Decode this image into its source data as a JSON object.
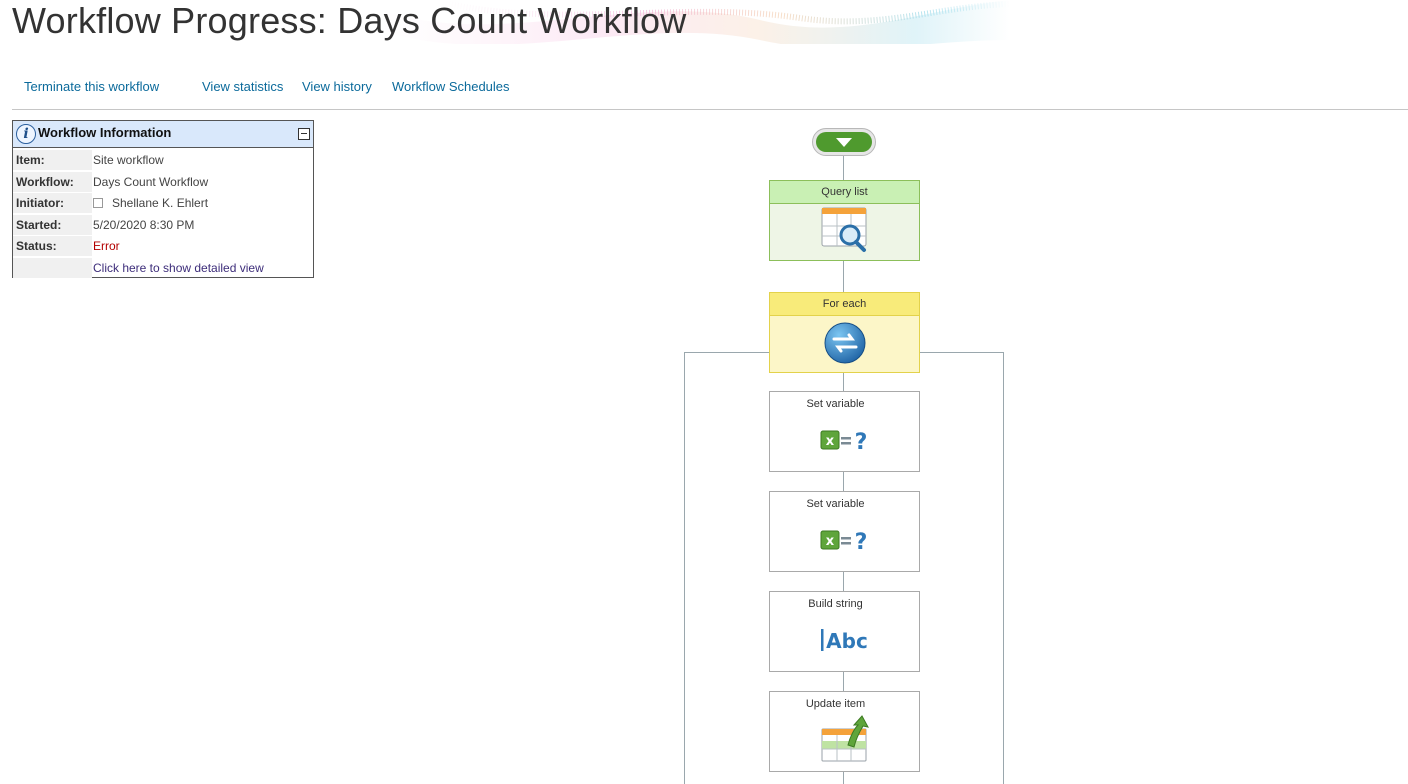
{
  "page": {
    "title": "Workflow Progress: Days Count Workflow"
  },
  "actions": {
    "terminate": "Terminate this workflow",
    "statistics": "View statistics",
    "history": "View history",
    "schedules": "Workflow Schedules"
  },
  "info": {
    "title": "Workflow Information",
    "rows": [
      {
        "label": "Item:",
        "value": "Site workflow"
      },
      {
        "label": "Workflow:",
        "value": "Days Count Workflow"
      },
      {
        "label": "Initiator:",
        "value": "Shellane K. Ehlert"
      },
      {
        "label": "Started:",
        "value": "5/20/2020 8:30 PM"
      },
      {
        "label": "Status:",
        "value": "Error"
      }
    ],
    "detail_link": "Click here to show detailed view"
  },
  "workflow": {
    "nodes": [
      {
        "label": "Query list",
        "icon": "query-list-icon",
        "state": "completed"
      },
      {
        "label": "For each",
        "icon": "for-each-icon",
        "state": "in-progress"
      },
      {
        "label": "Set variable",
        "icon": "set-variable-icon",
        "state": "not-started"
      },
      {
        "label": "Set variable",
        "icon": "set-variable-icon",
        "state": "not-started"
      },
      {
        "label": "Build string",
        "icon": "build-string-icon",
        "state": "not-started"
      },
      {
        "label": "Update item",
        "icon": "update-item-icon",
        "state": "not-started"
      }
    ],
    "colors": {
      "completed": "#c9f0b4",
      "in_progress": "#f8eb7a",
      "error": "#b30000",
      "link": "#0b6a9b"
    }
  }
}
